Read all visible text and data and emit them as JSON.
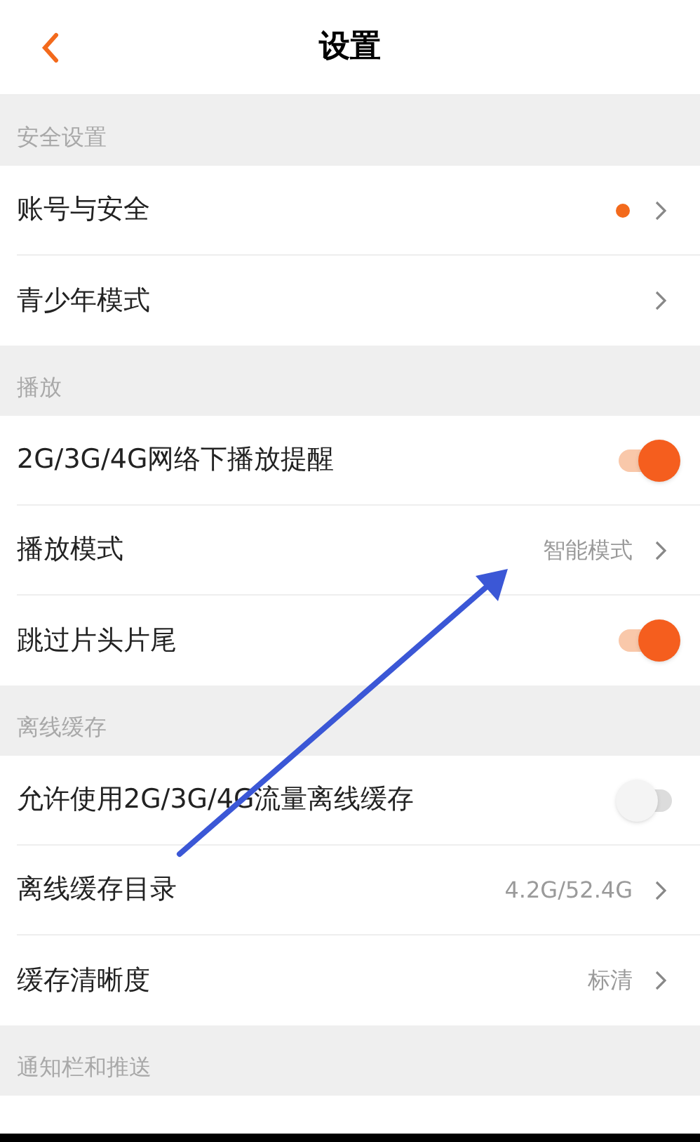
{
  "title": "设置",
  "sections": [
    {
      "title": "安全设置",
      "items": [
        {
          "kind": "link",
          "label": "账号与安全",
          "dot": true
        },
        {
          "kind": "link",
          "label": "青少年模式",
          "dot": false
        }
      ]
    },
    {
      "title": "播放",
      "items": [
        {
          "kind": "toggle",
          "label": "2G/3G/4G网络下播放提醒",
          "on": true
        },
        {
          "kind": "link",
          "label": "播放模式",
          "value": "智能模式",
          "dot": false
        },
        {
          "kind": "toggle",
          "label": "跳过片头片尾",
          "on": true
        }
      ]
    },
    {
      "title": "离线缓存",
      "items": [
        {
          "kind": "toggle",
          "label": "允许使用2G/3G/4G流量离线缓存",
          "on": false
        },
        {
          "kind": "link",
          "label": "离线缓存目录",
          "value": "4.2G/52.4G",
          "dot": false
        },
        {
          "kind": "link",
          "label": "缓存清晰度",
          "value": "标清",
          "dot": false
        }
      ]
    },
    {
      "title": "通知栏和推送"
    }
  ]
}
